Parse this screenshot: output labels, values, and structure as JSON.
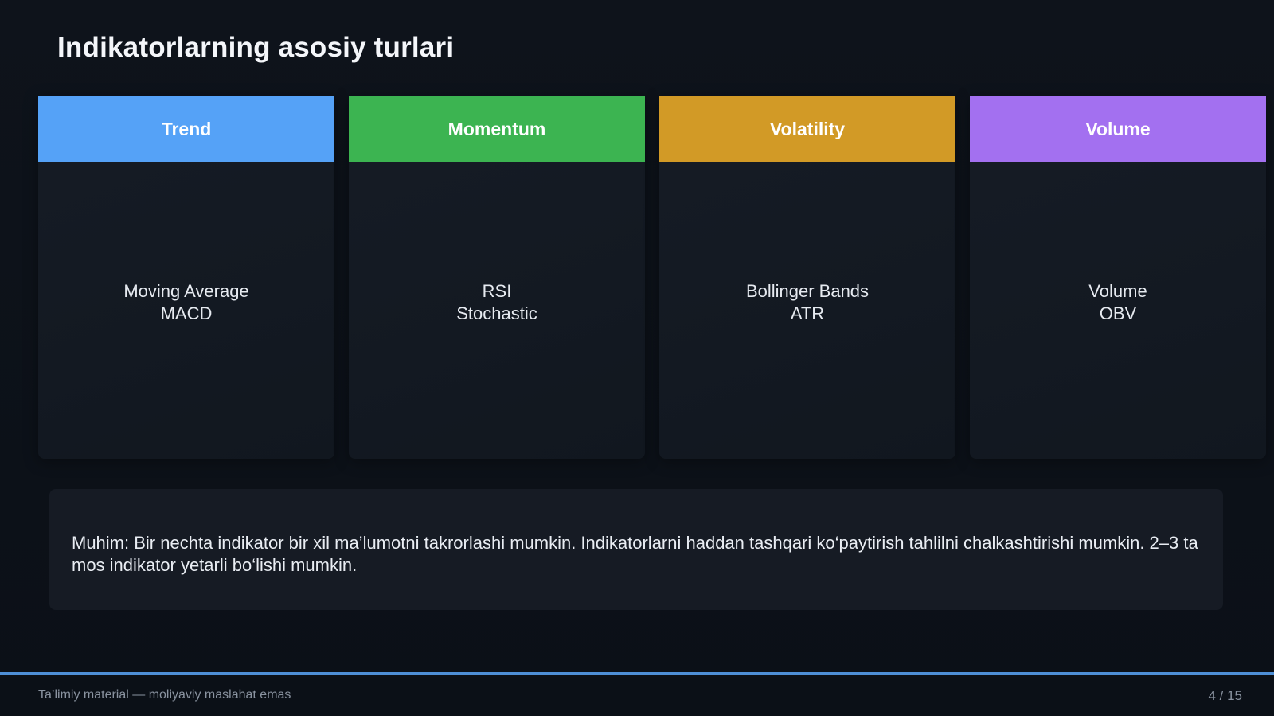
{
  "slide": {
    "title": "Indikatorlarning asosiy turlari",
    "cards": [
      {
        "label": "Trend",
        "color": "#55a2f7",
        "items": [
          "Moving Average",
          "MACD"
        ]
      },
      {
        "label": "Momentum",
        "color": "#3cb451",
        "items": [
          "RSI",
          "Stochastic"
        ]
      },
      {
        "label": "Volatility",
        "color": "#d29a26",
        "items": [
          "Bollinger Bands",
          "ATR"
        ]
      },
      {
        "label": "Volume",
        "color": "#a370f0",
        "items": [
          "Volume",
          "OBV"
        ]
      }
    ],
    "note": "Muhim: Bir nechta indikator bir xil ma’lumotni takrorlashi mumkin. Indikatorlarni haddan tashqari ko‘paytirish tahlilni chalkashtirishi mumkin. 2–3 ta mos indikator yetarli bo‘lishi mumkin."
  },
  "footer": {
    "left": "Ta’limiy material — moliyaviy maslahat emas",
    "page": "4 / 15",
    "accent": "#4e8fd6"
  }
}
